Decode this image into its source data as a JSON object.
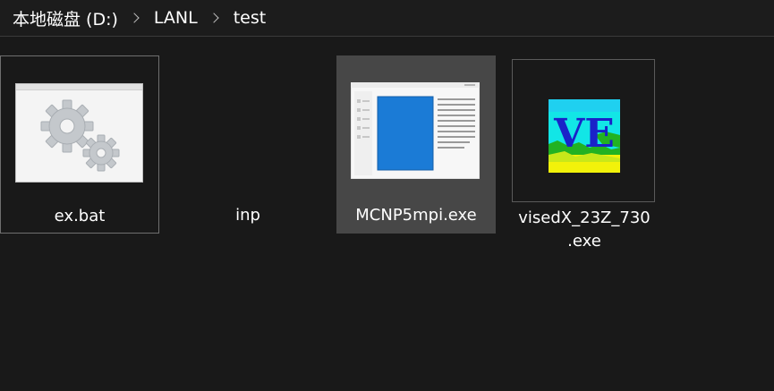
{
  "breadcrumb": {
    "drive": "本地磁盘 (D:)",
    "folder": "LANL",
    "subfolder": "test"
  },
  "items": [
    {
      "label": "ex.bat",
      "icon": "gears-icon"
    },
    {
      "label": "inp",
      "icon": "blank-document-icon"
    },
    {
      "label": "MCNP5mpi.exe",
      "icon": "application-window-icon"
    },
    {
      "label": "visedX_23Z_730\n.exe",
      "icon": "ve-logo-icon",
      "logo_text": "VE"
    }
  ],
  "colors": {
    "background": "#191919",
    "selection_fill": "#474747",
    "selection_outline": "#6f6f6f",
    "app_accent": "#1a73d9"
  }
}
